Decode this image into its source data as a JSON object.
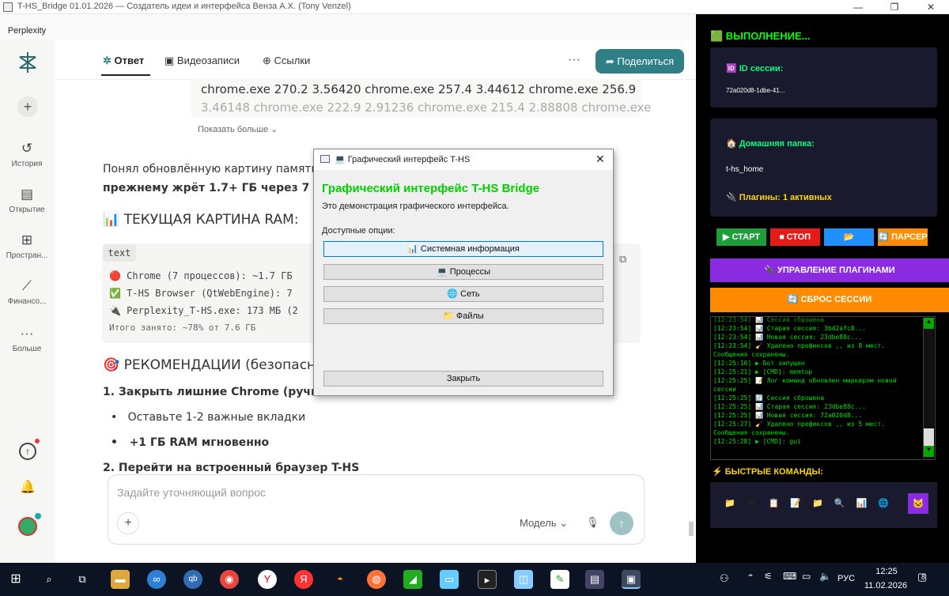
{
  "window": {
    "title": "T-HS_Bridge 01.01.2026 — Создатель идеи и интерфейса Венза А.Х. (Tony Venzel)",
    "min": "—",
    "max": "❐",
    "close": "✕"
  },
  "perplexity": {
    "tab": "Perplexity",
    "nav": [
      {
        "icon": "⊕",
        "label": ""
      },
      {
        "icon": "↺",
        "label": "История"
      },
      {
        "icon": "▤",
        "label": "Открытие"
      },
      {
        "icon": "⊞",
        "label": "Простран..."
      },
      {
        "icon": "⟋",
        "label": "Финансо..."
      },
      {
        "icon": "···",
        "label": "Больше"
      }
    ],
    "tabs": {
      "answer": "Ответ",
      "videos": "Видеозаписи",
      "links": "Ссылки"
    },
    "more": "···",
    "share": "Поделиться",
    "faded_line1": "chrome.exe 270.2 3.56420 chrome.exe 257.4 3.44612 chrome.exe 256.9",
    "faded_line2": "3.46148 chrome.exe 222.9 2.91236 chrome.exe 215.4 2.88808 chrome.exe",
    "show_more": "Показать больше ⌄",
    "para1a": "Понял обновлённую картину памяти. С",
    "para1b": "прежнему жрёт 1.7+ ГБ через 7 проце",
    "h_ram": "📊 ТЕКУЩАЯ КАРТИНА RAM:",
    "code_lang": "text",
    "code_lines": [
      "🔴 Chrome (7 процессов): ~1.7 ГБ",
      "✅ T-HS Browser (QtWebEngine): 7",
      "🔌 Perplexity_T-HS.exe: 173 МБ (2",
      "Итого занято: ~78% от 7.6 ГБ"
    ],
    "h_rec": "🎯 РЕКОМЕНДАЦИИ (безопасные",
    "rec1": "1. Закрыть лишние Chrome (ручной с",
    "bullets": [
      "Оставьте 1-2 важные вкладки",
      "+1 ГБ RAM мгновенно"
    ],
    "rec2": "2. Перейти на встроенный браузер T-HS",
    "placeholder": "Задайте уточняющий вопрос",
    "model": "Модель ⌄"
  },
  "dialog": {
    "title": "💻 Графический интерфейс T-HS",
    "heading": "Графический интерфейс T-HS Bridge",
    "desc": "Это демонстрация графического интерфейса.",
    "options_label": "Доступные опции:",
    "buttons": [
      "📊 Системная информация",
      "💻 Процессы",
      "🌐 Сеть",
      "📁 Файлы"
    ],
    "close": "Закрыть"
  },
  "panel": {
    "status": "🟩 ВЫПОЛНЕНИЕ...",
    "session_label": "🆔 ID сессии:",
    "session_id": "72a020d8-1dbe-41...",
    "home_label": "🏠 Домашняя папка:",
    "home_value": "t-hs_home",
    "plugins": "🔌 Плагины: 1 активных",
    "btn_start": "▶ СТАРТ",
    "btn_stop": "⏹ СТОП",
    "btn_open": "📂 ОТКРЫТЬ",
    "btn_parser": "🔄 ПАРСЕР",
    "btn_plugins": "🔌 УПРАВЛЕНИЕ ПЛАГИНАМИ",
    "btn_reset": "🔄 СБРОС СЕССИИ",
    "quick": "⚡ БЫСТРЫЕ КОМАНДЫ:",
    "quick_icons": [
      "📁",
      "🖥",
      "📋",
      "📝",
      "📁",
      "🔍",
      "📊",
      "🌐",
      "🐱"
    ],
    "log": [
      "[12:23:54] 📊 Старая сессия: 3bd2afc8...",
      "[12:23:54] 📊 Новая сессия: 23dbe88c...",
      "[12:23:54] 🧹 Удалено префиксов ,, из 8 мест.",
      "Сообщения сохранены.",
      "[12:25:16] ▶ Бот запущен",
      "[12:25:21] ▶ [CMD]: memtop",
      "[12:25:25] 📝 Лог команд обновлен маркером новой",
      "сессии",
      "[12:25:25] 🔄 Сессия сброшена",
      "[12:25:25] 📊 Старая сессия: 23dbe88c...",
      "[12:25:25] 📊 Новая сессия: 72a020d8...",
      "[12:25:27] 🧹 Удалено префиксов ,, из 5 мест.",
      "Сообщения сохранены.",
      "[12:25:28] ▶ [CMD]: gui"
    ]
  },
  "taskbar": {
    "lang": "РУС",
    "time": "12:25",
    "date": "11.02.2026",
    "notif": "8"
  },
  "colors": {
    "accent_teal": "#2e7f86",
    "green": "#00ff00",
    "purple": "#8a2be2",
    "orange": "#ff8c00",
    "card": "#1a1a2e"
  }
}
